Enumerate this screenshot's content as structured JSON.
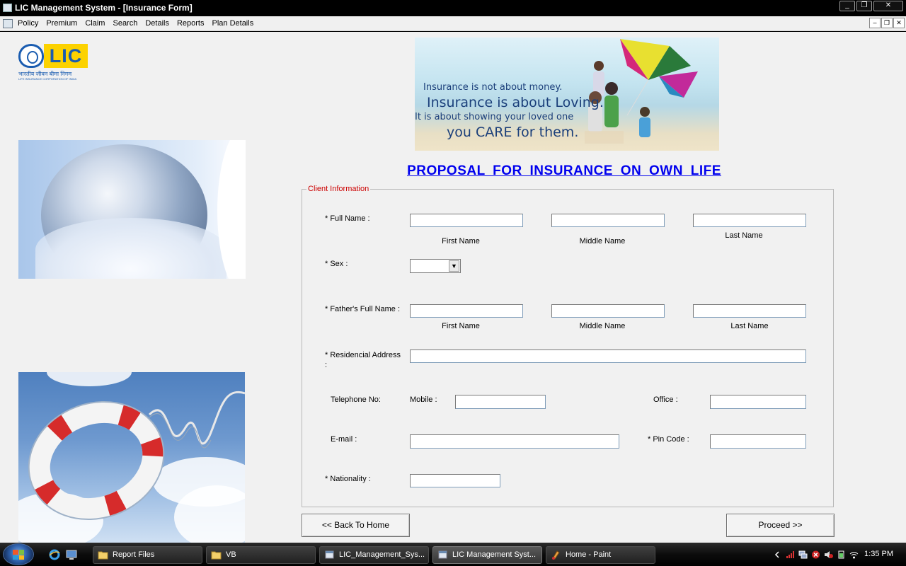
{
  "window": {
    "title": "LIC Management System - [Insurance Form]",
    "controls": {
      "minimize": "_",
      "restore": "❐",
      "close": "✕"
    },
    "mdi_controls": {
      "minimize": "–",
      "restore": "❐",
      "close": "✕"
    }
  },
  "menu": [
    "Policy",
    "Premium",
    "Claim",
    "Search",
    "Details",
    "Reports",
    "Plan Details"
  ],
  "logo": {
    "word": "LIC",
    "hindi": "भारतीय जीवन बीमा निगम",
    "corp": "LIFE INSURANCE CORPORATION OF INDIA"
  },
  "banner": {
    "line1": "Insurance is not about money.",
    "line2": "Insurance is about Loving.",
    "line3": "It is about showing your loved one",
    "line4": "you CARE for them."
  },
  "form": {
    "title": "PROPOSAL  FOR  INSURANCE  ON  OWN  LIFE",
    "group_label": "Client Information",
    "full_name_label": "* Full Name :",
    "first_name": "First Name",
    "middle_name": "Middle Name",
    "last_name": "Last Name",
    "sex_label": "* Sex :",
    "sex_value": "",
    "fathers_name_label": "* Father's Full Name :",
    "address_label": "* Residencial Address :",
    "telephone_label": "Telephone No:",
    "mobile_label": "Mobile :",
    "office_label": "Office :",
    "email_label": "E-mail :",
    "pincode_label": "* Pin Code :",
    "nationality_label": "* Nationality :",
    "fields": {
      "first_name": "",
      "middle_name": "",
      "last_name": "",
      "father_first": "",
      "father_middle": "",
      "father_last": "",
      "address": "",
      "mobile": "",
      "office": "",
      "email": "",
      "pincode": "",
      "nationality": ""
    }
  },
  "buttons": {
    "back": "<< Back To Home",
    "proceed": "Proceed >>"
  },
  "taskbar": {
    "items": [
      {
        "label": "Report Files",
        "icon": "folder-icon",
        "active": false
      },
      {
        "label": "VB",
        "icon": "folder-icon",
        "active": false
      },
      {
        "label": "LIC_Management_Sys...",
        "icon": "app-icon",
        "active": false
      },
      {
        "label": "LIC Management Syst...",
        "icon": "app-icon",
        "active": true
      },
      {
        "label": "Home - Paint",
        "icon": "paint-icon",
        "active": false
      }
    ],
    "clock": "1:35 PM"
  },
  "colors": {
    "title_link": "#0000ee",
    "group_label": "#cc0000",
    "lic_blue": "#1a5cb0",
    "lic_yellow": "#fcd200"
  }
}
